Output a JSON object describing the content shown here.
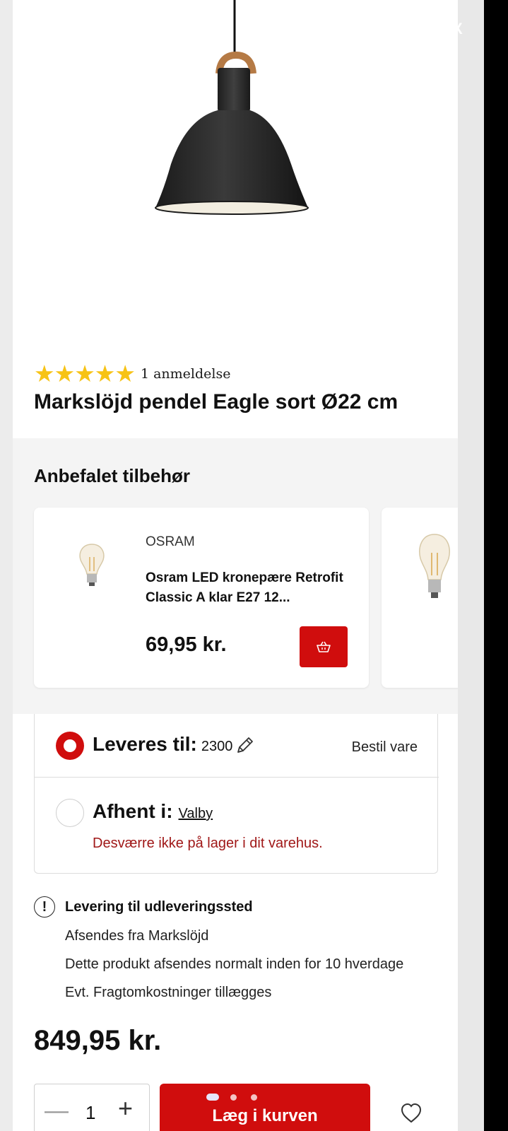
{
  "product": {
    "title": "Markslöjd pendel Eagle sort Ø22 cm",
    "rating_stars": 5,
    "review_count_label": "1 anmeldelse",
    "price": "849,95 kr."
  },
  "accessories": {
    "title": "Anbefalet tilbehør",
    "items": [
      {
        "brand": "OSRAM",
        "name": "Osram LED kronepære Retrofit Classic A klar E27 12...",
        "price": "69,95 kr."
      }
    ]
  },
  "delivery": {
    "option_1": {
      "label": "Leveres til:",
      "zip": "2300",
      "action": "Bestil vare",
      "selected": true
    },
    "option_2": {
      "label": "Afhent i:",
      "store": "Valby",
      "stock_message": "Desværre ikke på lager i dit varehus.",
      "selected": false
    }
  },
  "shipping": {
    "title": "Levering til udleveringssted",
    "lines": [
      "Afsendes fra Markslöjd",
      "Dette produkt afsendes normalt inden for 10 hverdage",
      "Evt. Fragtomkostninger tillægges"
    ]
  },
  "cart": {
    "quantity": "1",
    "add_label": "Læg i kurven"
  },
  "icons": {
    "close": "X",
    "info": "!",
    "minus": "—",
    "plus": "+"
  },
  "colors": {
    "accent": "#d00d0d",
    "star": "#f7c315",
    "error_text": "#a01818"
  }
}
